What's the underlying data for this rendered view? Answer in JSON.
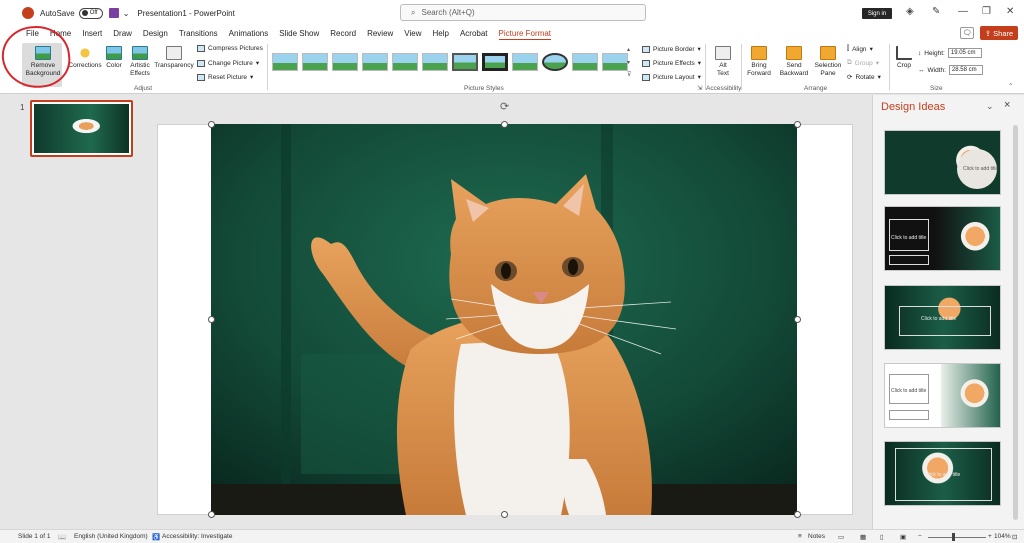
{
  "titlebar": {
    "autosave_label": "AutoSave",
    "autosave_state": "Off",
    "doc_title": "Presentation1 - PowerPoint",
    "search_placeholder": "Search (Alt+Q)",
    "signin": "Sign in"
  },
  "tabs": [
    "File",
    "Home",
    "Insert",
    "Draw",
    "Design",
    "Transitions",
    "Animations",
    "Slide Show",
    "Record",
    "Review",
    "View",
    "Help",
    "Acrobat",
    "Picture Format"
  ],
  "active_tab": "Picture Format",
  "share_label": "Share",
  "ribbon": {
    "remove_background": [
      "Remove",
      "Background"
    ],
    "corrections": "Corrections",
    "color": "Color",
    "artistic_effects": [
      "Artistic",
      "Effects"
    ],
    "transparency": "Transparency",
    "compress": "Compress Pictures",
    "change_picture": "Change Picture",
    "reset_picture": "Reset Picture",
    "adjust_label": "Adjust",
    "picture_styles_label": "Picture Styles",
    "picture_border": "Picture Border",
    "picture_effects": "Picture Effects",
    "picture_layout": "Picture Layout",
    "alt_text": [
      "Alt",
      "Text"
    ],
    "accessibility_label": "Accessibility",
    "bring_forward": [
      "Bring",
      "Forward"
    ],
    "send_backward": [
      "Send",
      "Backward"
    ],
    "selection_pane": [
      "Selection",
      "Pane"
    ],
    "align": "Align",
    "group": "Group",
    "rotate": "Rotate",
    "arrange_label": "Arrange",
    "crop": "Crop",
    "height_label": "Height:",
    "height_value": "19.05 cm",
    "width_label": "Width:",
    "width_value": "28.58 cm",
    "size_label": "Size"
  },
  "slides": {
    "number": "1"
  },
  "design_pane": {
    "title": "Design Ideas",
    "ideas": [
      {
        "text": "Click to add title"
      },
      {
        "text": "Click to add title"
      },
      {
        "text": "Click to add title"
      },
      {
        "text": "Click to add title"
      },
      {
        "text": "Click to add title"
      }
    ]
  },
  "statusbar": {
    "slide_info": "Slide 1 of 1",
    "language": "English (United Kingdom)",
    "accessibility": "Accessibility: Investigate",
    "notes": "Notes",
    "zoom": "104%"
  },
  "colors": {
    "accent": "#c43e1c",
    "annotation_circle": "#d8262c"
  }
}
